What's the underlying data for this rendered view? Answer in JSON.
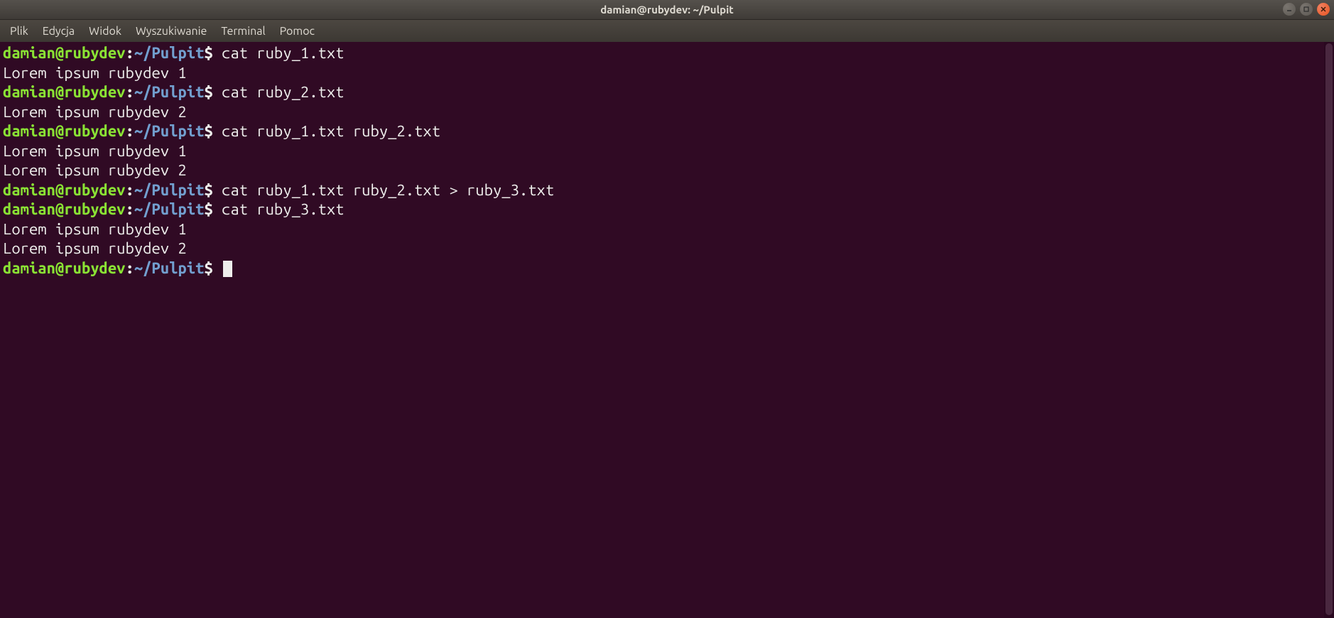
{
  "titlebar": {
    "title": "damian@rubydev: ~/Pulpit"
  },
  "menubar": {
    "items": [
      "Plik",
      "Edycja",
      "Widok",
      "Wyszukiwanie",
      "Terminal",
      "Pomoc"
    ]
  },
  "prompt": {
    "user_host": "damian@rubydev",
    "path": "~/Pulpit",
    "symbol": "$"
  },
  "session": [
    {
      "type": "cmd",
      "command": "cat ruby_1.txt"
    },
    {
      "type": "out",
      "text": "Lorem ipsum rubydev 1"
    },
    {
      "type": "cmd",
      "command": "cat ruby_2.txt"
    },
    {
      "type": "out",
      "text": "Lorem ipsum rubydev 2"
    },
    {
      "type": "cmd",
      "command": "cat ruby_1.txt ruby_2.txt"
    },
    {
      "type": "out",
      "text": "Lorem ipsum rubydev 1"
    },
    {
      "type": "out",
      "text": "Lorem ipsum rubydev 2"
    },
    {
      "type": "cmd",
      "command": "cat ruby_1.txt ruby_2.txt > ruby_3.txt"
    },
    {
      "type": "cmd",
      "command": "cat ruby_3.txt"
    },
    {
      "type": "out",
      "text": "Lorem ipsum rubydev 1"
    },
    {
      "type": "out",
      "text": "Lorem ipsum rubydev 2"
    },
    {
      "type": "cmd",
      "command": "",
      "cursor": true
    }
  ]
}
